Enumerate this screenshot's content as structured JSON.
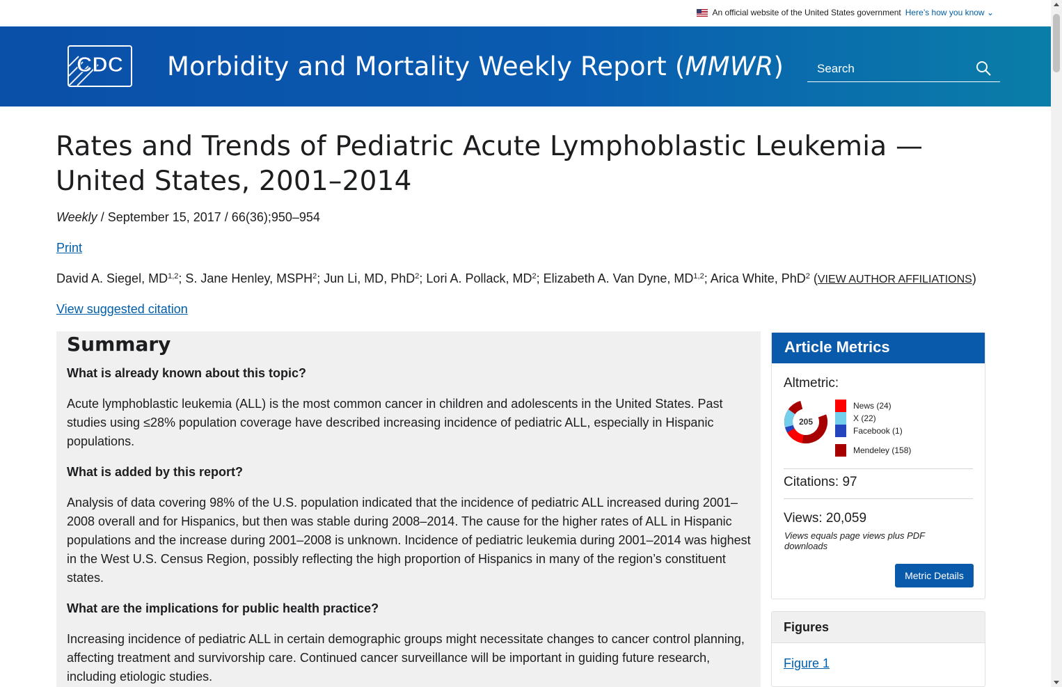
{
  "gov_banner": {
    "text": "An official website of the United States government",
    "link": "Here’s how you know",
    "chevron": "⌄"
  },
  "header": {
    "logo_text": "CDC",
    "title_main": "Morbidity and Mortality Weekly Report (",
    "title_em": "MMWR",
    "title_end": ")",
    "search_placeholder": "Search"
  },
  "article": {
    "title": "Rates and Trends of Pediatric Acute Lymphoblastic Leukemia — United States, 2001–2014",
    "series": "Weekly",
    "pub_rest": " / September 15, 2017 / 66(36);950–954",
    "print_label": "Print",
    "authors": [
      {
        "name": "David A. Siegel, MD",
        "sup": "1,2"
      },
      {
        "name": "; S. Jane Henley, MSPH",
        "sup": "2"
      },
      {
        "name": "; Jun Li, MD, PhD",
        "sup": "2"
      },
      {
        "name": "; Lori A. Pollack, MD",
        "sup": "2"
      },
      {
        "name": "; Elizabeth A. Van Dyne, MD",
        "sup": "1,2"
      },
      {
        "name": "; Arica White, PhD",
        "sup": "2"
      }
    ],
    "affiliations_open": " (",
    "affiliations_link": "VIEW AUTHOR AFFILIATIONS",
    "affiliations_close": ")",
    "citation_link": "View suggested citation"
  },
  "summary": {
    "heading": "Summary",
    "q1": "What is already known about this topic?",
    "a1": "Acute lymphoblastic leukemia (ALL) is the most common cancer in children and adolescents in the United States. Past studies using ≤28% population coverage have described increasing incidence of pediatric ALL, especially in Hispanic populations.",
    "q2": "What is added by this report?",
    "a2": "Analysis of data covering 98% of the U.S. population indicated that the incidence of pediatric ALL increased during 2001–2008 overall and for Hispanics, but then was stable during 2008–2014. The cause for the higher rates of ALL in Hispanic populations and the increase during 2001–2008 is unknown. Incidence of pediatric leukemia during 2001–2014 was highest in the West U.S. Census Region, possibly reflecting the high proportion of Hispanics in many of the region’s constituent states.",
    "q3": "What are the implications for public health practice?",
    "a3": "Increasing incidence of pediatric ALL in certain demographic groups might necessitate changes to cancer control planning, affecting treatment and survivorship care. Continued cancer surveillance will be important in guiding future research, including etiologic studies."
  },
  "metrics": {
    "heading": "Article Metrics",
    "altmetric_label": "Altmetric:",
    "score": "205",
    "legend": [
      {
        "label": "News (24)",
        "color": "#ff0000"
      },
      {
        "label": "X (22)",
        "color": "#74cfed"
      },
      {
        "label": "Facebook (1)",
        "color": "#2445bd"
      },
      {
        "label": "Mendeley (158)",
        "color": "#a60000"
      }
    ],
    "citations": "Citations: 97",
    "views": "Views: 20,059",
    "views_note": "Views equals page views plus PDF downloads",
    "button": "Metric Details"
  },
  "figures": {
    "heading": "Figures",
    "items": [
      "Figure 1"
    ]
  },
  "colors": {
    "brand_blue": "#0a5aab",
    "link": "#005eaa",
    "summary_bg": "#f0f0f0"
  }
}
